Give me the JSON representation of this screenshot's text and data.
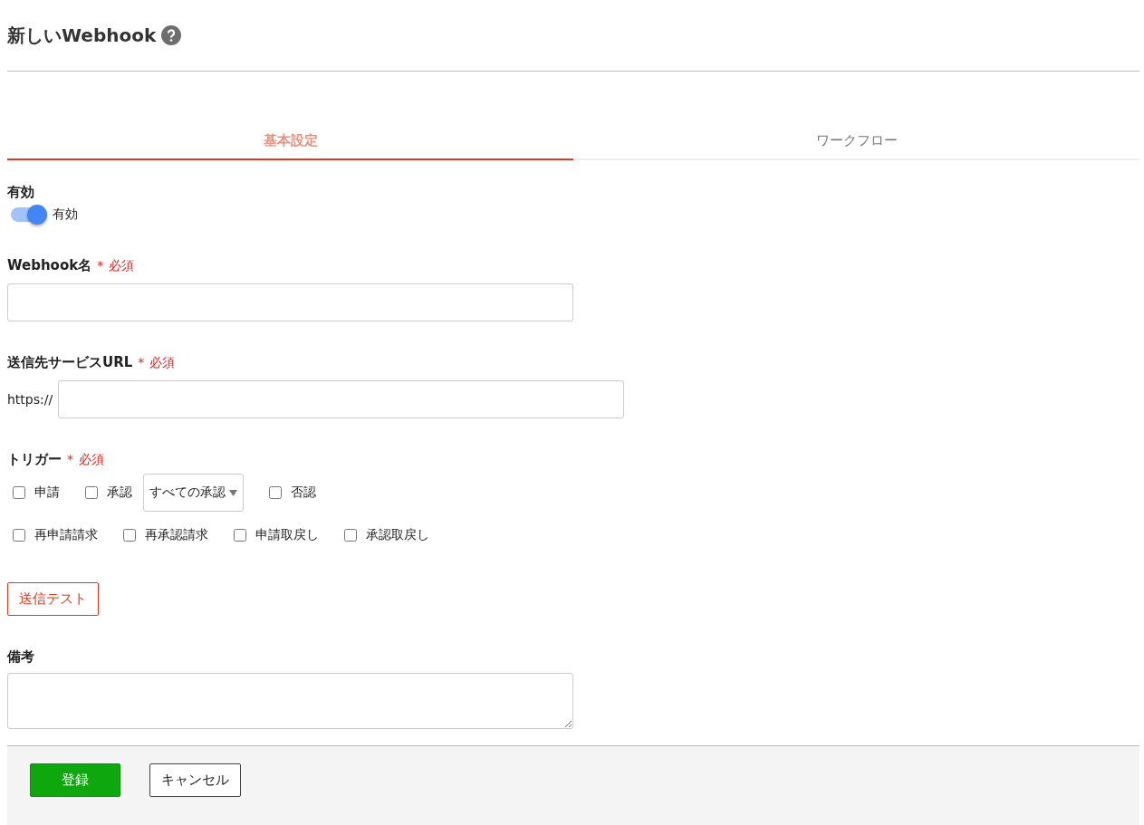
{
  "title": "新しいWebhook",
  "tabs": [
    {
      "label": "基本設定",
      "selected": true
    },
    {
      "label": "ワークフロー",
      "selected": false
    }
  ],
  "enabled": {
    "label": "有効",
    "toggle_label": "有効",
    "on": true
  },
  "name_field": {
    "label": "Webhook名",
    "required_mark": "*",
    "required_text": "必須"
  },
  "url_field": {
    "label": "送信先サービスURL",
    "required_mark": "*",
    "required_text": "必須",
    "prefix": "https://"
  },
  "trigger": {
    "label": "トリガー",
    "required_mark": "*",
    "required_text": "必須",
    "rows": [
      {
        "options": [
          {
            "label": "申請",
            "checked": false
          },
          {
            "label": "承認",
            "checked": false,
            "filter": "すべての承認"
          },
          {
            "label": "否認",
            "checked": false
          }
        ]
      },
      {
        "options": [
          {
            "label": "再申請請求",
            "checked": false
          },
          {
            "label": "再承認請求",
            "checked": false
          },
          {
            "label": "申請取戻し",
            "checked": false
          },
          {
            "label": "承認取戻し",
            "checked": false
          }
        ]
      }
    ]
  },
  "test_button": "送信テスト",
  "notes": {
    "label": "備考"
  },
  "footer": {
    "submit": "登録",
    "cancel": "キャンセル"
  }
}
